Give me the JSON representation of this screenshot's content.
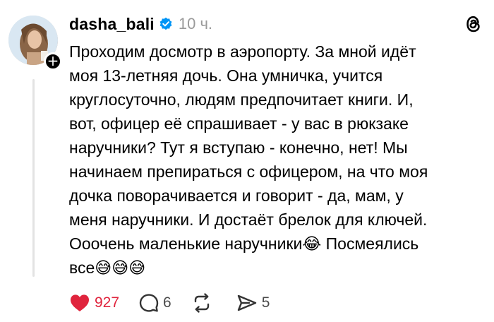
{
  "post": {
    "username": "dasha_bali",
    "time": "10 ч.",
    "text": "Проходим досмотр в аэропорту. За мной идёт\nмоя 13-летняя дочь. Она умничка, учится\nкруглосуточно, людям предпочитает книги. И,\nвот, офицер её спрашивает - у вас в рюкзаке\nнаручники? Тут я вступаю - конечно, нет! Мы\nначинаем препираться с офицером, на что моя\nдочка поворачивается и говорит - да, мам, у\nменя наручники. И достаёт брелок для ключей.\nОоочень маленькие наручники😂 Посмеялись\nвсе😅😅😅"
  },
  "actions": {
    "likes": "927",
    "comments": "6",
    "reposts": "",
    "shares": "5"
  },
  "icons": {
    "like": "heart-icon",
    "comment": "comment-bubble-icon",
    "repost": "repost-icon",
    "share": "send-icon",
    "verified": "verified-badge-icon",
    "app": "threads-logo-icon",
    "follow": "plus-icon"
  },
  "colors": {
    "like": "#e0243d",
    "verified": "#0095f6",
    "time": "#9a9a9a",
    "thread_line": "#e3e3e3"
  }
}
